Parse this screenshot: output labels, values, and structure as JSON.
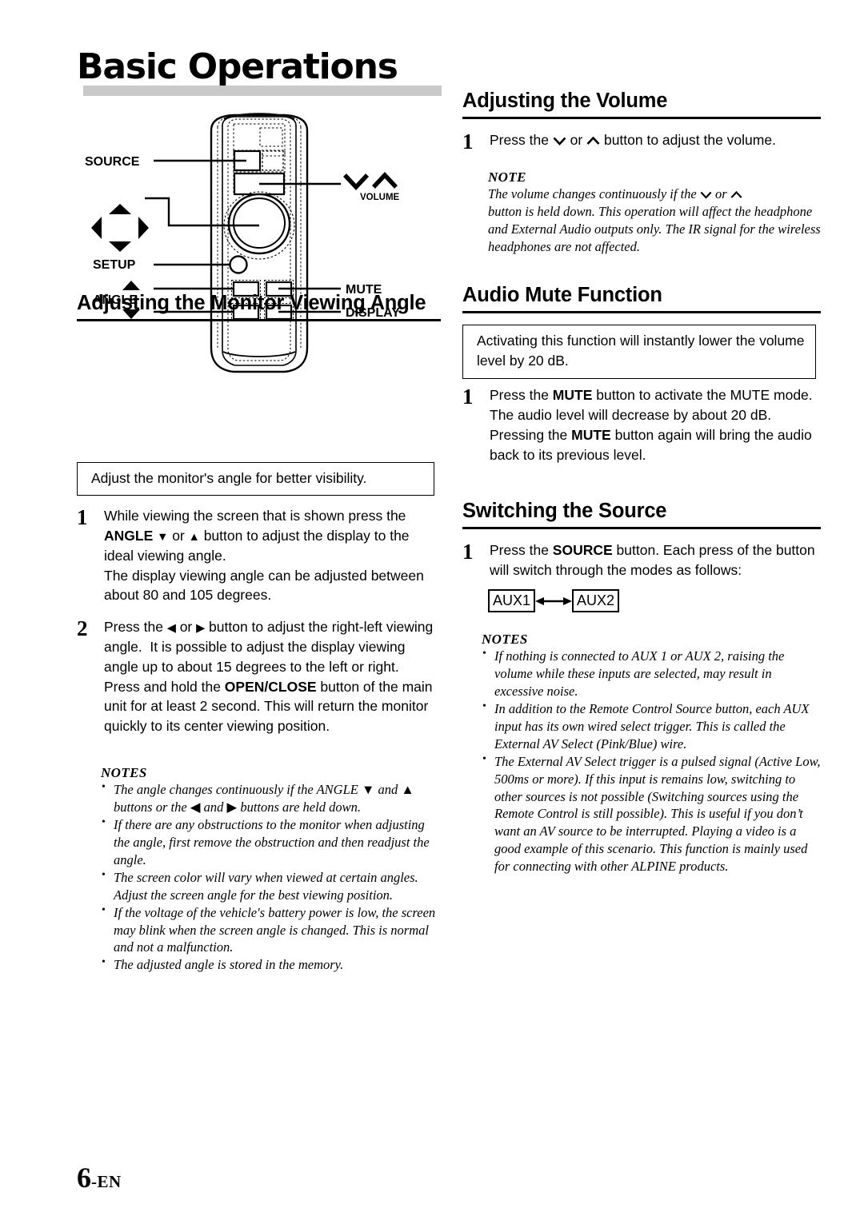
{
  "page": {
    "title": "Basic Operations",
    "number_value": "6",
    "number_suffix": "-EN"
  },
  "remote_diagram": {
    "name": "remote-control-illustration",
    "labels": {
      "source": "SOURCE",
      "volume": "VOLUME",
      "setup": "SETUP",
      "angle": "ANGLE",
      "mute": "MUTE",
      "display": "DISPLAY"
    }
  },
  "left_column": {
    "heading": "Adjusting the Monitor Viewing Angle",
    "callout": "Adjust the monitor's angle for better visibility.",
    "steps": [
      {
        "number": "1",
        "segments": [
          {
            "text": "While viewing the screen that is shown press the ",
            "bold": false
          },
          {
            "text": "ANGLE ",
            "bold": true
          },
          {
            "text": "▼",
            "bold": true,
            "glyph": true
          },
          {
            "text": " or ",
            "bold": false
          },
          {
            "text": "▲",
            "bold": true,
            "glyph": true
          },
          {
            "text": " button to adjust the display to the ideal viewing angle.",
            "bold": false
          },
          {
            "text": "\n",
            "bold": false,
            "break": true
          },
          {
            "text": "The display viewing angle can be adjusted between about 80 and 105 degrees.",
            "bold": false
          }
        ]
      },
      {
        "number": "2",
        "segments": [
          {
            "text": "Press the ",
            "bold": false
          },
          {
            "text": "◀",
            "bold": false,
            "glyph": true
          },
          {
            "text": " or ",
            "bold": false
          },
          {
            "text": "▶",
            "bold": false,
            "glyph": true
          },
          {
            "text": " button to adjust the right-left viewing angle.  It is possible to adjust the display viewing angle up to about 15 degrees to the left or right.",
            "bold": false
          },
          {
            "text": "\n",
            "bold": false,
            "break": true
          },
          {
            "text": "Press and hold the ",
            "bold": false
          },
          {
            "text": "OPEN/CLOSE",
            "bold": true
          },
          {
            "text": " button of the main unit for at least 2 second. This will return the monitor quickly to its center viewing position.",
            "bold": false
          }
        ]
      }
    ],
    "notes_title": "NOTES",
    "notes": [
      "The angle changes continuously if the ANGLE ▼ and ▲ buttons or the ◀ and ▶ buttons are held down.",
      "If there are any obstructions to the monitor when adjusting the angle, first remove the obstruction and then readjust the angle.",
      "The screen color will vary when viewed at certain angles. Adjust the screen angle for the best viewing position.",
      "If the voltage of the vehicle's battery power is low, the screen may blink when the screen angle is changed. This is normal and not a malfunction.",
      "The adjusted angle is stored in the memory."
    ]
  },
  "right_column": {
    "volume_section": {
      "heading": "Adjusting the Volume",
      "step_number": "1",
      "step_text_before": "Press the ",
      "step_glyph_down": "⌄",
      "step_text_mid": " or ",
      "step_glyph_up": "⌃",
      "step_text_after": " button to adjust the volume.",
      "note_title": "NOTE",
      "note_text": "The volume changes continuously if the ⌄ or ⌃ button is held down. This operation will affect the headphone and External Audio outputs only. The IR signal for the wireless headphones are not affected."
    },
    "mute_section": {
      "heading": "Audio Mute Function",
      "callout": "Activating this function will instantly lower the volume level by 20 dB.",
      "step_number": "1",
      "step_segments": [
        {
          "text": "Press the ",
          "bold": false
        },
        {
          "text": "MUTE",
          "bold": true
        },
        {
          "text": " button to activate the MUTE mode. The audio level will decrease by about 20 dB.",
          "bold": false
        },
        {
          "text": "\n",
          "bold": false,
          "break": true
        },
        {
          "text": "Pressing the ",
          "bold": false
        },
        {
          "text": "MUTE",
          "bold": true
        },
        {
          "text": " button again will bring the audio back to its previous level.",
          "bold": false
        }
      ]
    },
    "source_section": {
      "heading": "Switching the Source",
      "step_number": "1",
      "step_segments": [
        {
          "text": "Press the ",
          "bold": false
        },
        {
          "text": "SOURCE",
          "bold": true
        },
        {
          "text": " button. Each press of the button will switch through the modes as follows:",
          "bold": false
        }
      ],
      "aux_first": "AUX1",
      "aux_second": "AUX2",
      "notes_title": "NOTES",
      "notes": [
        "If nothing is connected to AUX 1 or AUX 2, raising the volume while these inputs are selected, may result in excessive noise.",
        "In addition to the Remote Control Source button, each AUX input has its own wired select trigger.  This is called the External AV Select (Pink/Blue) wire.",
        "The External AV Select trigger is a pulsed signal (Active Low, 500ms or more).  If this input is remains low, switching to other sources is not possible (Switching sources using the Remote Control is still possible).  This is useful if you don’t want an AV source to be interrupted.  Playing a video is a good example of this scenario.  This function is mainly used for connecting with other ALPINE products."
      ]
    }
  },
  "colors": {
    "title_band": "#c9c9c9",
    "rule": "#000000",
    "text": "#000000"
  }
}
